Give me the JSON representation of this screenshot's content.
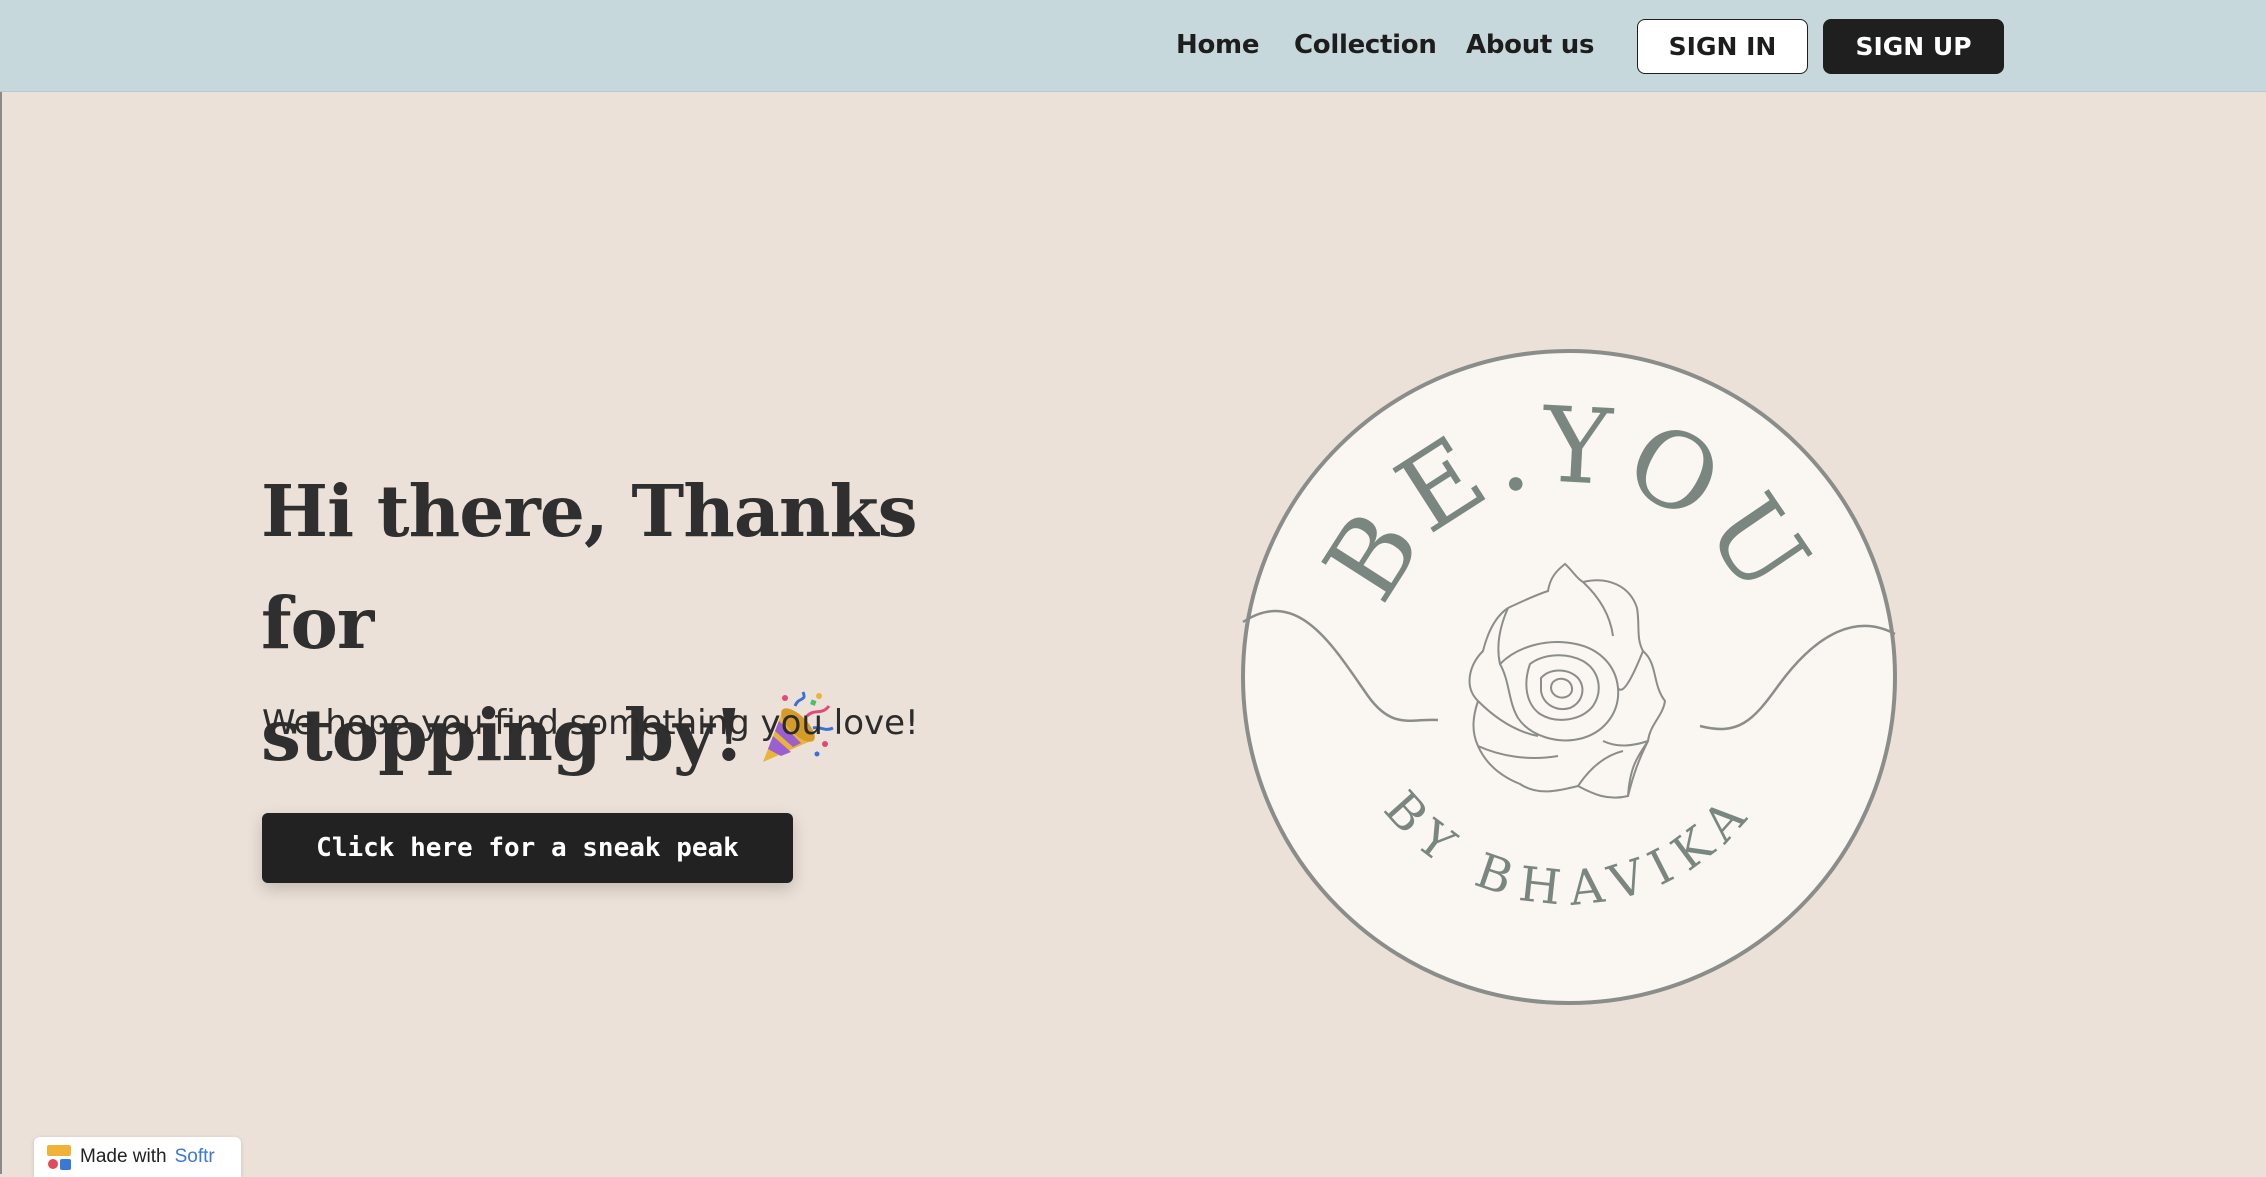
{
  "nav": {
    "links": [
      "Home",
      "Collection",
      "About us"
    ],
    "sign_in": "SIGN IN",
    "sign_up": "SIGN UP"
  },
  "hero": {
    "title_line1": "Hi there, Thanks for",
    "title_line2": "stopping by!",
    "title_emoji": "party-popper-icon",
    "subtitle": "We hope you find something you love!",
    "cta_label": "Click here for a sneak peak"
  },
  "logo": {
    "top_text": "BE.YOU",
    "bottom_text": "BY BHAVIKA",
    "icon": "rose-icon"
  },
  "badge": {
    "made_with": "Made with",
    "brand": "Softr",
    "icon": "softr-logo-icon"
  },
  "colors": {
    "background": "#ece1d8",
    "header": "#c6d8dc",
    "dark": "#1f1f1f",
    "logo_text": "#7a8780",
    "logo_fill": "#faf6f1"
  }
}
